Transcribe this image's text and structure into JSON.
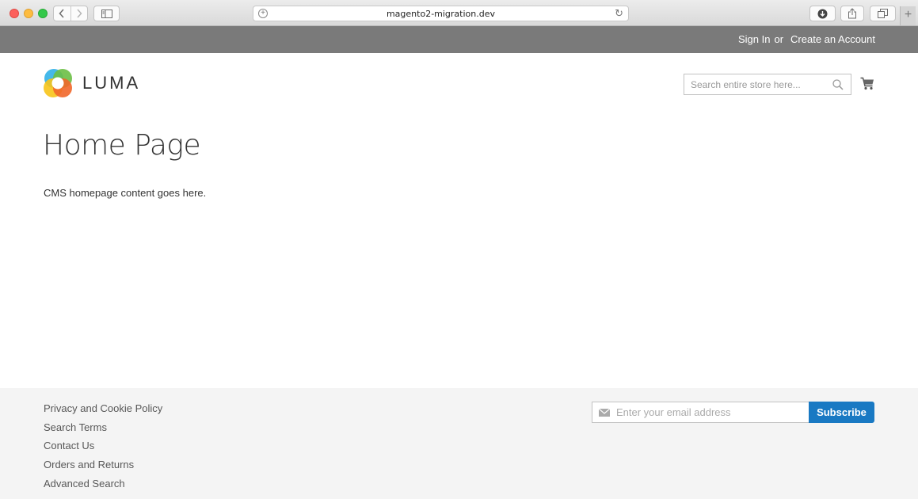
{
  "browser": {
    "url": "magento2-migration.dev"
  },
  "panel": {
    "sign_in": "Sign In",
    "or": "or",
    "create_account": "Create an Account"
  },
  "header": {
    "logo_text": "LUMA",
    "search_placeholder": "Search entire store here..."
  },
  "main": {
    "title": "Home Page",
    "content": "CMS homepage content goes here."
  },
  "footer": {
    "links": [
      "Privacy and Cookie Policy",
      "Search Terms",
      "Contact Us",
      "Orders and Returns",
      "Advanced Search"
    ],
    "newsletter_placeholder": "Enter your email address",
    "subscribe_label": "Subscribe"
  },
  "colors": {
    "panel_bg": "#7a7a7a",
    "subscribe_bg": "#1979c3",
    "footer_bg": "#f4f4f4"
  }
}
